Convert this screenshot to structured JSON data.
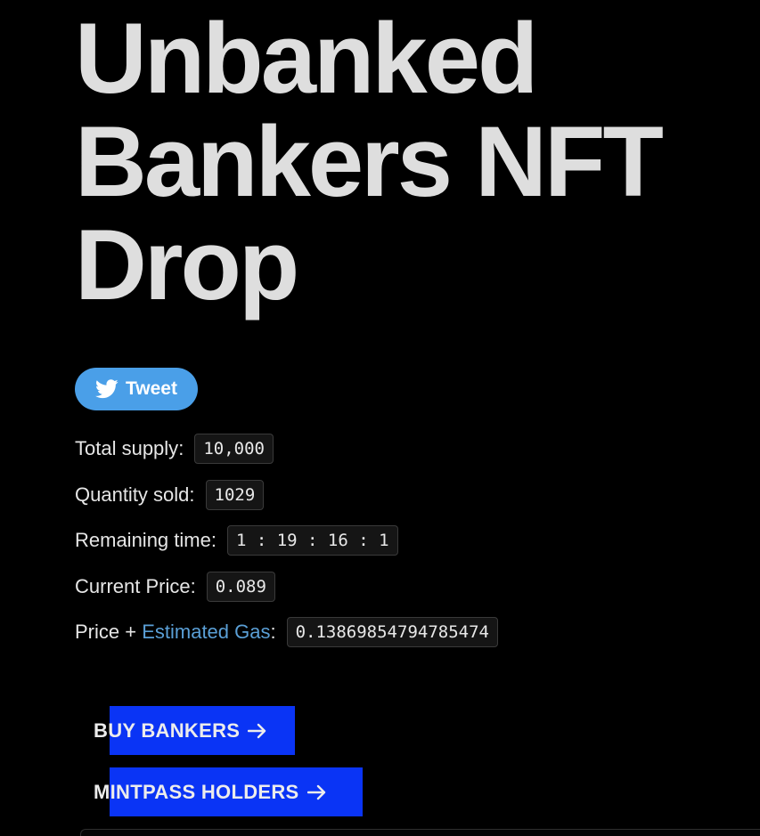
{
  "page": {
    "title_lines": [
      "Unbanked",
      "Bankers NFT",
      "Drop"
    ]
  },
  "tweet_button": {
    "label": "Tweet",
    "icon": "twitter-bird-icon",
    "color": "#4a9fe8"
  },
  "stats": {
    "total_supply": {
      "label": "Total supply",
      "value": "10,000"
    },
    "quantity_sold": {
      "label": "Quantity sold",
      "value": "1029"
    },
    "remaining_time": {
      "label": "Remaining time",
      "value": "1 : 19 : 16 : 1"
    },
    "current_price": {
      "label": "Current Price",
      "value": "0.089"
    },
    "price_gas": {
      "label_prefix": "Price + ",
      "link_text": "Estimated Gas",
      "value": "0.13869854794785474",
      "link_color": "#5a9fd6"
    }
  },
  "actions": {
    "buy_bankers": {
      "label": "BUY BANKERS",
      "icon": "arrow-right-icon"
    },
    "mintpass_holders": {
      "label": "MINTPASS HOLDERS",
      "icon": "arrow-right-icon"
    },
    "accent_color": "#0a34f5"
  }
}
